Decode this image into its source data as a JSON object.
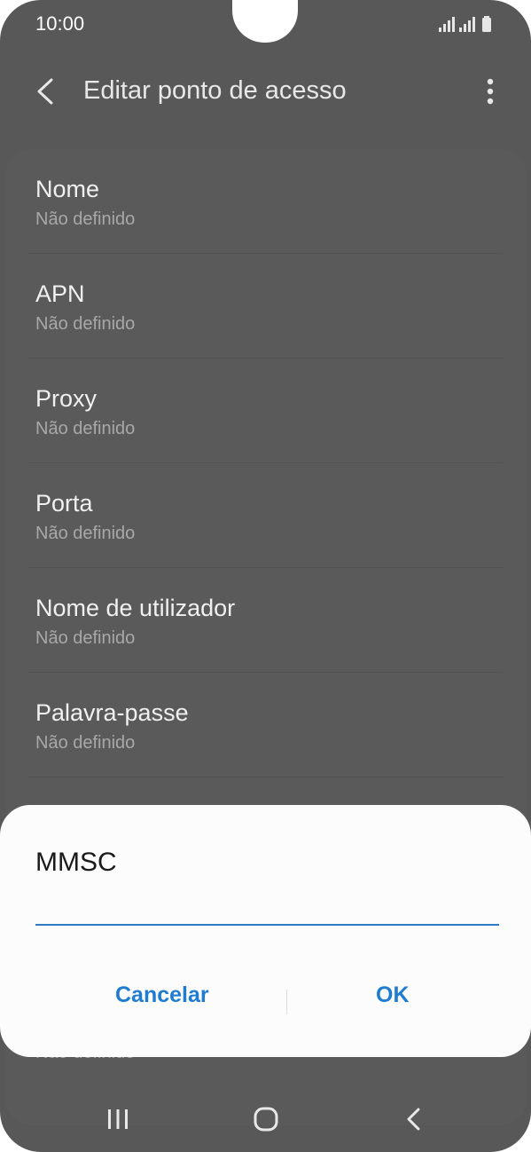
{
  "status": {
    "time": "10:00"
  },
  "appbar": {
    "title": "Editar ponto de acesso"
  },
  "settings": {
    "rows": [
      {
        "label": "Nome",
        "value": "Não definido"
      },
      {
        "label": "APN",
        "value": "Não definido"
      },
      {
        "label": "Proxy",
        "value": "Não definido"
      },
      {
        "label": "Porta",
        "value": "Não definido"
      },
      {
        "label": "Nome de utilizador",
        "value": "Não definido"
      },
      {
        "label": "Palavra-passe",
        "value": "Não definido"
      }
    ],
    "behind_value": "Não definido"
  },
  "dialog": {
    "title": "MMSC",
    "input_value": "",
    "cancel_label": "Cancelar",
    "ok_label": "OK"
  },
  "colors": {
    "accent": "#1f7cd0",
    "scrim": "#585858",
    "dialog_bg": "#fcfcfc"
  },
  "icons": [
    "back-arrow-icon",
    "more-vertical-icon",
    "signal-icon",
    "battery-icon",
    "recents-icon",
    "home-icon",
    "back-icon"
  ]
}
